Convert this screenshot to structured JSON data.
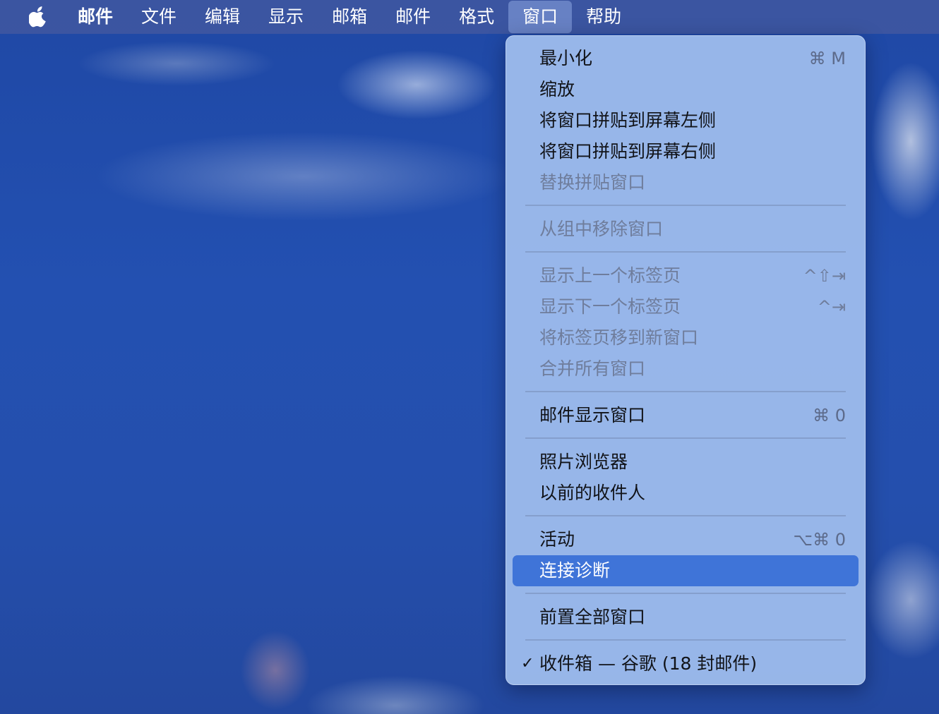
{
  "menubar": {
    "apple_icon": "apple-logo-icon",
    "titles": [
      "邮件",
      "文件",
      "编辑",
      "显示",
      "邮箱",
      "邮件",
      "格式",
      "窗口",
      "帮助"
    ],
    "active_title": "窗口"
  },
  "window_menu": {
    "items": [
      {
        "label": "最小化",
        "shortcut": "⌘ M",
        "enabled": true
      },
      {
        "label": "缩放",
        "shortcut": "",
        "enabled": true
      },
      {
        "label": "将窗口拼贴到屏幕左侧",
        "shortcut": "",
        "enabled": true
      },
      {
        "label": "将窗口拼贴到屏幕右侧",
        "shortcut": "",
        "enabled": true
      },
      {
        "label": "替换拼贴窗口",
        "shortcut": "",
        "enabled": false
      },
      {
        "label": "从组中移除窗口",
        "shortcut": "",
        "enabled": false
      },
      {
        "label": "显示上一个标签页",
        "shortcut": "^⇧⇥",
        "enabled": false
      },
      {
        "label": "显示下一个标签页",
        "shortcut": "^⇥",
        "enabled": false
      },
      {
        "label": "将标签页移到新窗口",
        "shortcut": "",
        "enabled": false
      },
      {
        "label": "合并所有窗口",
        "shortcut": "",
        "enabled": false
      },
      {
        "label": "邮件显示窗口",
        "shortcut": "⌘ 0",
        "enabled": true
      },
      {
        "label": "照片浏览器",
        "shortcut": "",
        "enabled": true
      },
      {
        "label": "以前的收件人",
        "shortcut": "",
        "enabled": true
      },
      {
        "label": "活动",
        "shortcut": "⌥⌘ 0",
        "enabled": true
      },
      {
        "label": "连接诊断",
        "shortcut": "",
        "enabled": true,
        "highlighted": true
      },
      {
        "label": "前置全部窗口",
        "shortcut": "",
        "enabled": true
      },
      {
        "label": "收件箱 — 谷歌 (18 封邮件)",
        "shortcut": "",
        "enabled": true,
        "checked": true,
        "check_mark": "✓"
      }
    ]
  },
  "colors": {
    "highlight": "#3f74d8",
    "menu_background": "#a0beee",
    "menubar_background": "#465aa0"
  }
}
